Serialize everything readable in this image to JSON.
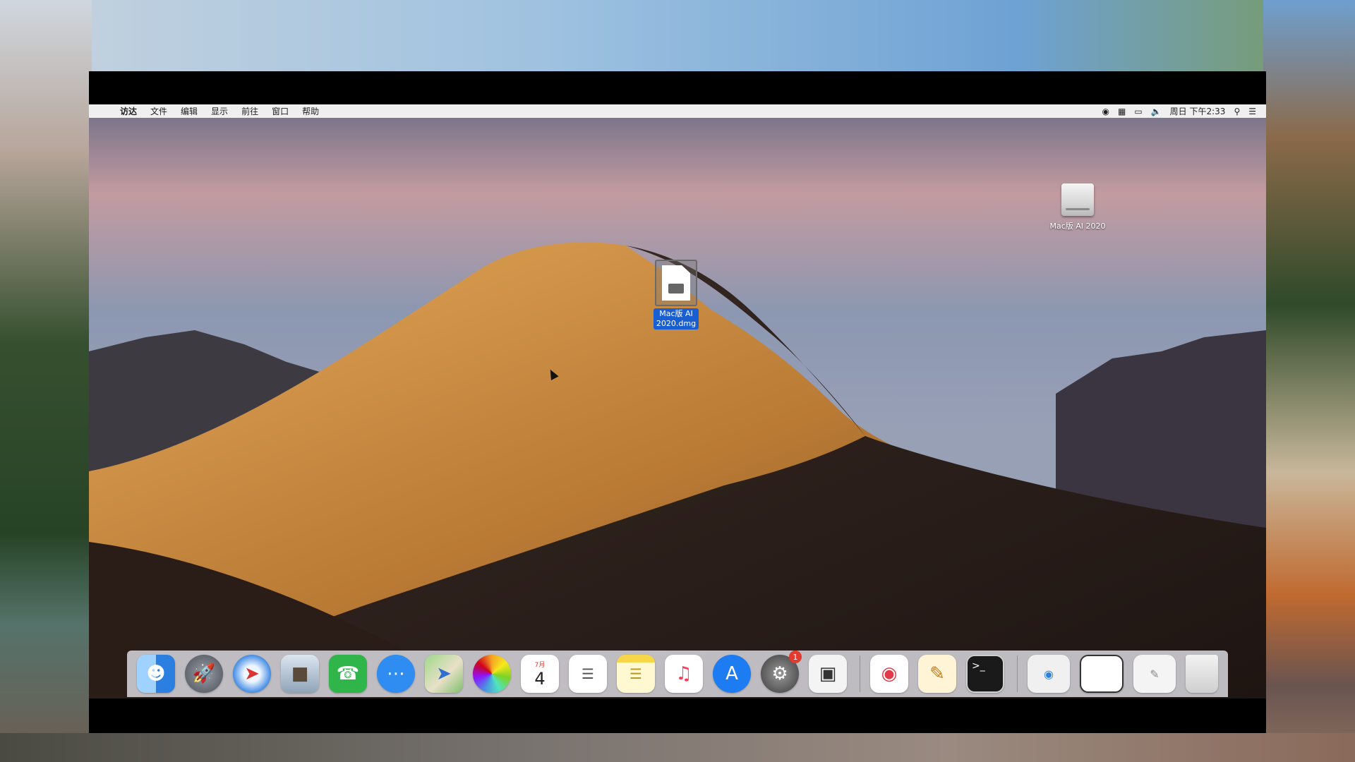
{
  "menubar": {
    "app_name": "访达",
    "menus": [
      "文件",
      "编辑",
      "显示",
      "前往",
      "窗口",
      "帮助"
    ],
    "clock": "周日 下午2:33"
  },
  "desktop_icons": {
    "drive_label": "Mac版 AI 2020",
    "dmg_label_line1": "Mac版 AI",
    "dmg_label_line2": "2020.dmg"
  },
  "dock": {
    "apps": [
      {
        "name": "finder",
        "color": "#3a8de0"
      },
      {
        "name": "launchpad",
        "color": "#6b6f78"
      },
      {
        "name": "safari",
        "color": "#2f7fe0"
      },
      {
        "name": "preview",
        "color": "#8fa3b8"
      },
      {
        "name": "facetime",
        "color": "#30b54a"
      },
      {
        "name": "messages",
        "color": "#2f8cf0"
      },
      {
        "name": "maps",
        "color": "#7fbf6a"
      },
      {
        "name": "photos",
        "color": "#f3f3f3"
      },
      {
        "name": "calendar",
        "color": "#ffffff"
      },
      {
        "name": "reminders",
        "color": "#ffffff"
      },
      {
        "name": "notes",
        "color": "#f7d64a"
      },
      {
        "name": "music",
        "color": "#ffffff"
      },
      {
        "name": "app-store",
        "color": "#1e7cf2"
      },
      {
        "name": "system-preferences",
        "color": "#6b6b6b"
      },
      {
        "name": "screenshot",
        "color": "#ffffff"
      }
    ],
    "calendar_month": "7月",
    "calendar_day": "4",
    "settings_badge": "1",
    "terminal_prompt": ">_"
  }
}
